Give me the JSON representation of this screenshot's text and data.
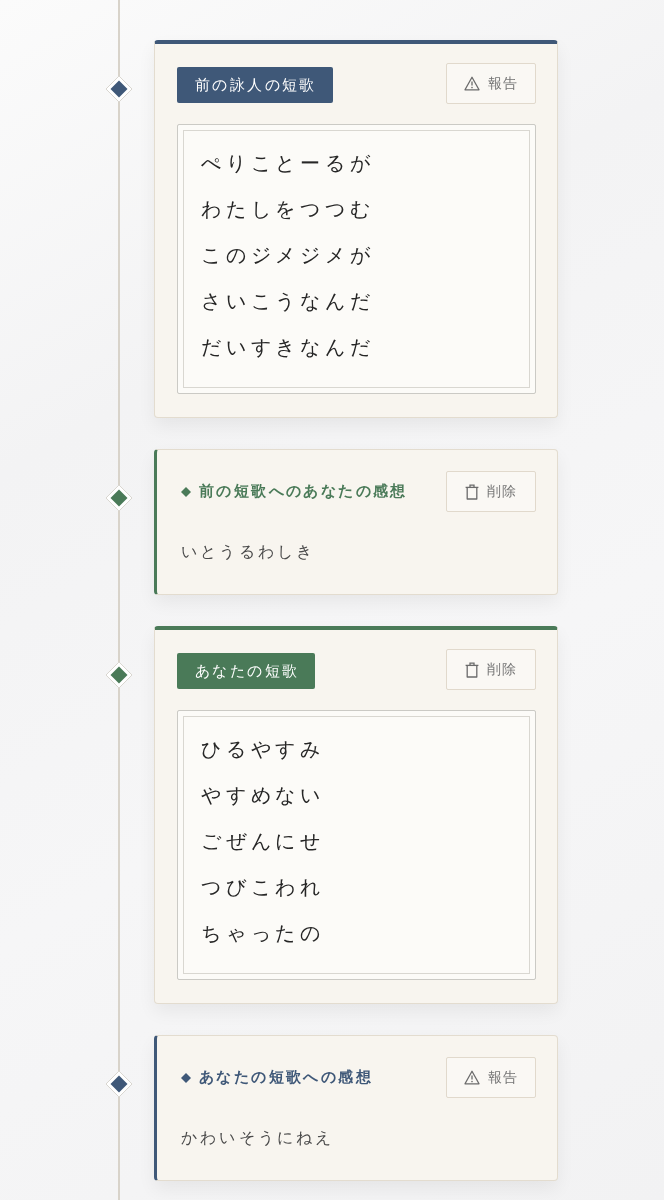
{
  "timeline": {
    "entries": [
      {
        "kind": "tanka",
        "label": "前の詠人の短歌",
        "color": "#3f5878",
        "action": {
          "kind": "report",
          "label": "報告"
        },
        "lines": [
          "ぺりことーるが",
          "わたしをつつむ",
          "このジメジメが",
          "さいこうなんだ",
          "だいすきなんだ"
        ]
      },
      {
        "kind": "comment",
        "title": "前の短歌へのあなたの感想",
        "color": "#4a7a58",
        "action": {
          "kind": "delete",
          "label": "削除"
        },
        "text": "いとうるわしき"
      },
      {
        "kind": "tanka",
        "label": "あなたの短歌",
        "color": "#4a7a58",
        "action": {
          "kind": "delete",
          "label": "削除"
        },
        "lines": [
          "ひるやすみ",
          "やすめない",
          "ごぜんにせ",
          "つびこわれ",
          "ちゃったの"
        ]
      },
      {
        "kind": "comment",
        "title": "あなたの短歌への感想",
        "color": "#3f5878",
        "action": {
          "kind": "report",
          "label": "報告"
        },
        "text": "かわいそうにねえ"
      }
    ]
  }
}
